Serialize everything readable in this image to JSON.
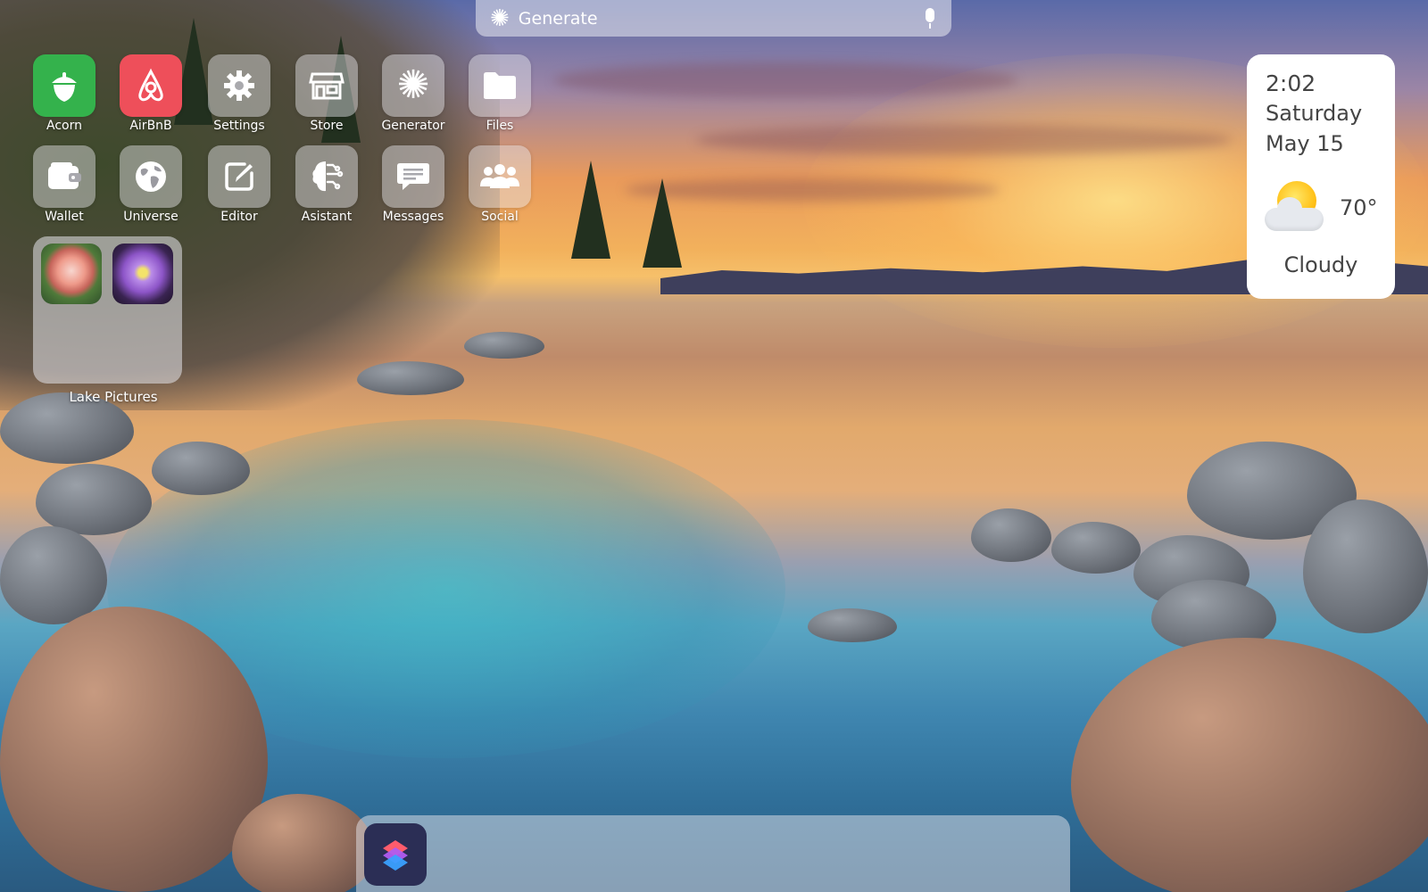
{
  "search": {
    "placeholder": "Generate",
    "icon": "sparkle-icon",
    "mic_icon": "microphone-icon"
  },
  "apps": [
    {
      "label": "Acorn",
      "icon": "acorn-icon",
      "color": "#34b24c"
    },
    {
      "label": "AirBnB",
      "icon": "airbnb-icon",
      "color": "#ee4f5a"
    },
    {
      "label": "Settings",
      "icon": "gear-icon"
    },
    {
      "label": "Store",
      "icon": "store-icon"
    },
    {
      "label": "Generator",
      "icon": "sparkle-icon"
    },
    {
      "label": "Files",
      "icon": "folder-icon"
    },
    {
      "label": "Wallet",
      "icon": "wallet-icon"
    },
    {
      "label": "Universe",
      "icon": "globe-icon"
    },
    {
      "label": "Editor",
      "icon": "edit-icon"
    },
    {
      "label": "Asistant",
      "icon": "brain-icon"
    },
    {
      "label": "Messages",
      "icon": "chat-icon"
    },
    {
      "label": "Social",
      "icon": "people-icon"
    }
  ],
  "folder": {
    "label": "Lake Pictures",
    "items": [
      "pink-dahlia-photo",
      "purple-flower-photo"
    ]
  },
  "widget": {
    "time": "2:02",
    "day": "Saturday",
    "date": "May 15",
    "temperature": "70°",
    "condition": "Cloudy",
    "weather_icon": "partly-cloudy-icon"
  },
  "dock": {
    "apps": [
      {
        "icon": "shortcuts-icon"
      }
    ]
  }
}
